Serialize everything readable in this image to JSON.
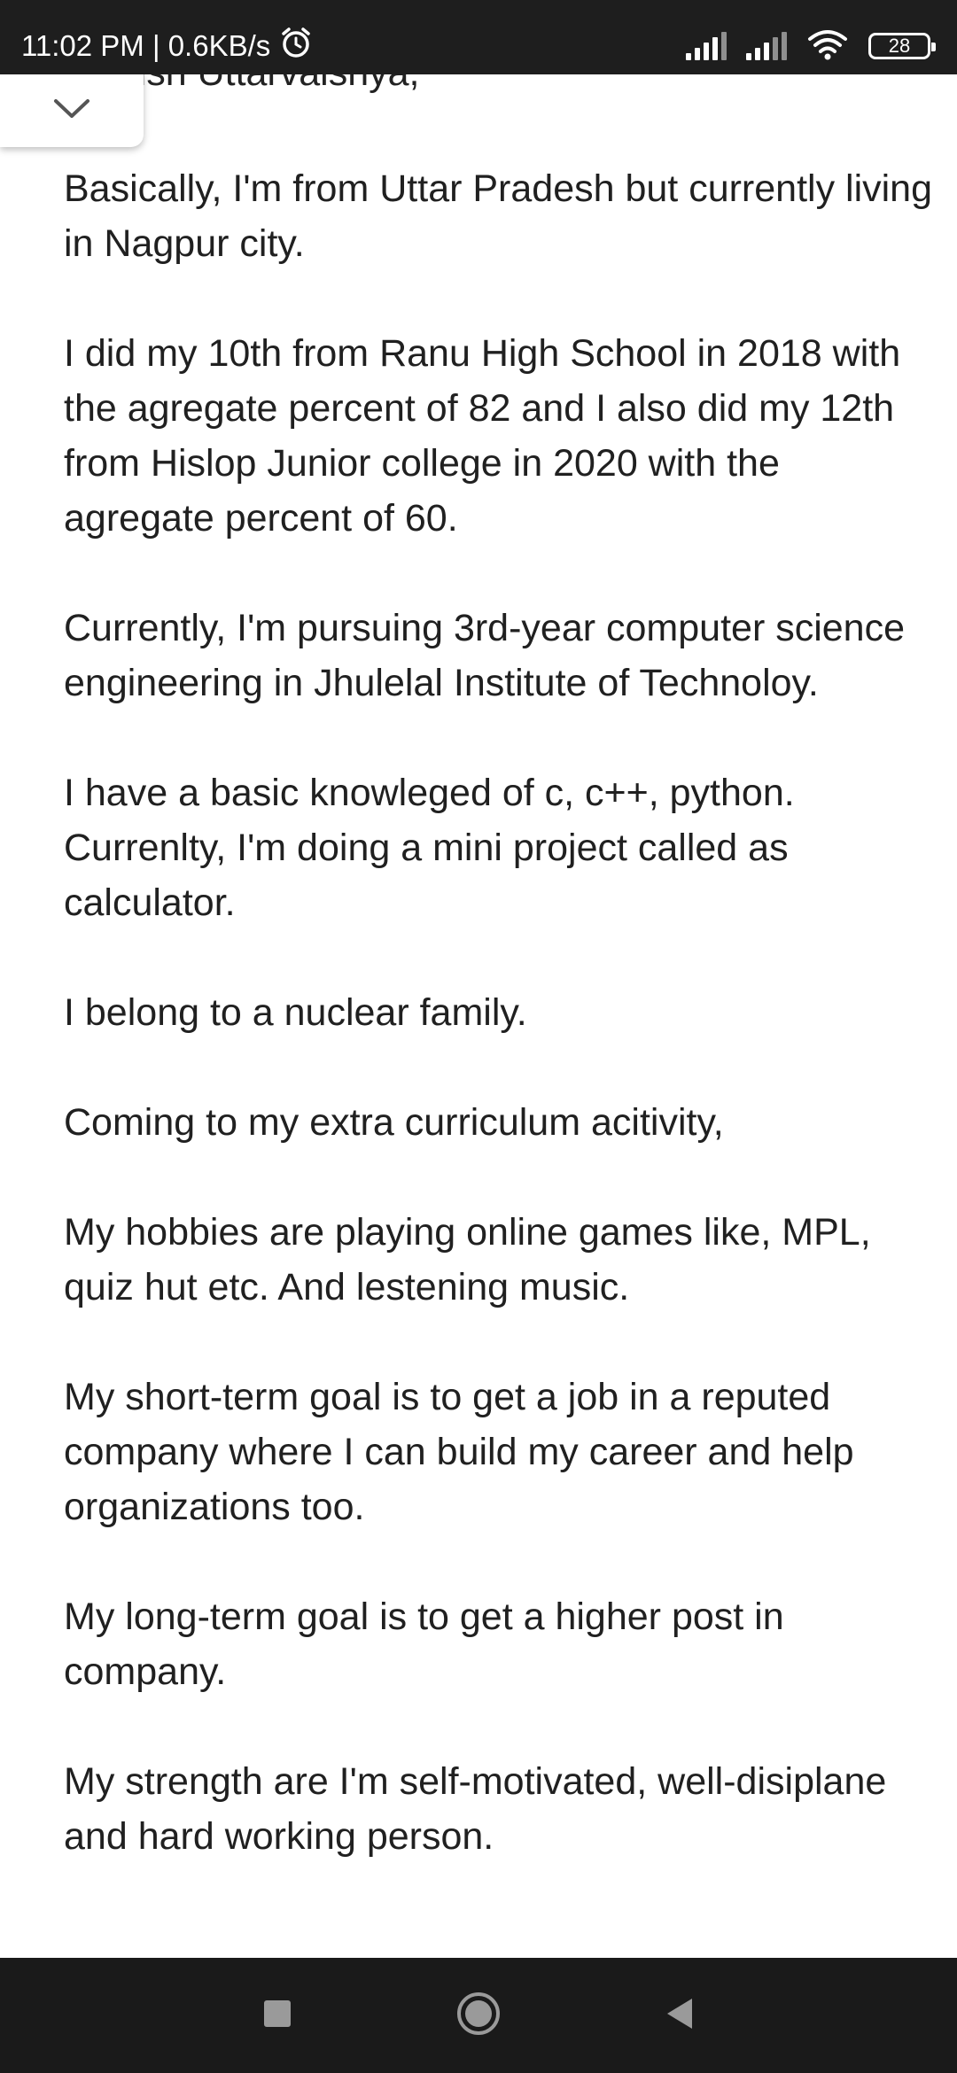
{
  "status_bar": {
    "time_speed": "11:02 PM | 0.6KB/s",
    "battery": "28"
  },
  "content": {
    "partial_top_line": "Manish Uttarvalshya,",
    "paragraphs": [
      "Basically, I'm from Uttar Pradesh but currently living in Nagpur city.",
      "I did my 10th from Ranu High School in 2018 with the agregate percent of 82 and I also did my 12th from Hislop Junior college in 2020 with the agregate percent of 60.",
      "Currently, I'm pursuing 3rd-year computer science engineering in Jhulelal Institute of Technoloy.",
      "I have a basic knowleged of c, c++, python. Currenlty, I'm doing a mini project called as calculator.",
      "I belong to a nuclear family.",
      "Coming to my extra curriculum acitivity,",
      "My hobbies are playing online games like, MPL, quiz hut etc. And lestening music.",
      "My short-term goal is to get a job in a reputed company where I can build my career and help organizations too.",
      "My long-term goal is to get a higher post in company.",
      "My strength are I'm self-motivated, well-disiplane and hard working person."
    ]
  },
  "icons": {
    "collapse": "chevron-down-icon",
    "alarm": "alarm-clock-icon",
    "signal": "signal-icon",
    "wifi": "wifi-icon",
    "battery": "battery-icon",
    "recents": "square-icon",
    "home": "circle-icon",
    "back": "triangle-back-icon"
  }
}
